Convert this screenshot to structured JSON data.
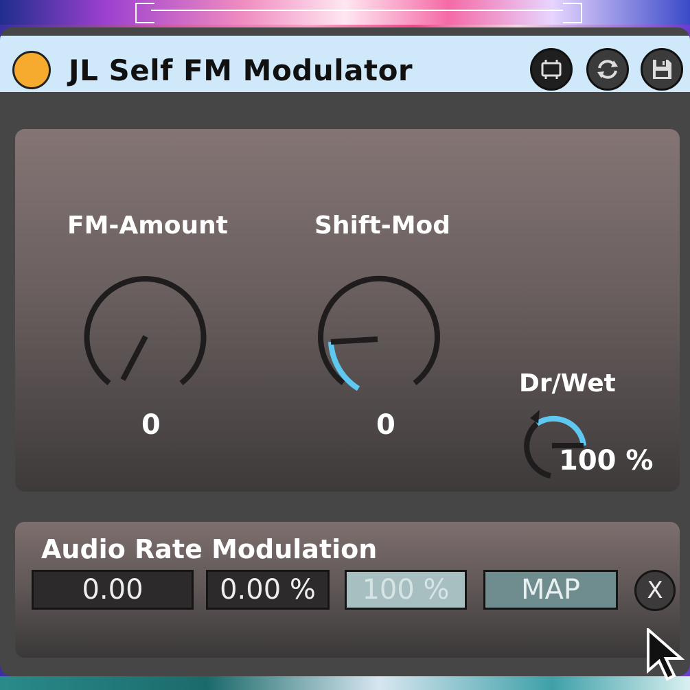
{
  "device": {
    "title": "JL Self FM Modulator",
    "power_color": "#f6ab2e",
    "title_bar_color": "#cfe9fa",
    "header_buttons": [
      "map-icon",
      "refresh-icon",
      "save-icon"
    ]
  },
  "controls": {
    "fm_amount": {
      "label": "FM-Amount",
      "value": "0"
    },
    "shift_mod": {
      "label": "Shift-Mod",
      "value": "0"
    },
    "dry_wet": {
      "label": "Dr/Wet",
      "value": "100 %"
    }
  },
  "modulation": {
    "title": "Audio Rate Modulation",
    "fields": [
      "0.00",
      "0.00 %",
      "100 %",
      "MAP"
    ],
    "close_label": "X"
  },
  "colors": {
    "accent": "#5ec8f0",
    "panel": "#464646"
  }
}
